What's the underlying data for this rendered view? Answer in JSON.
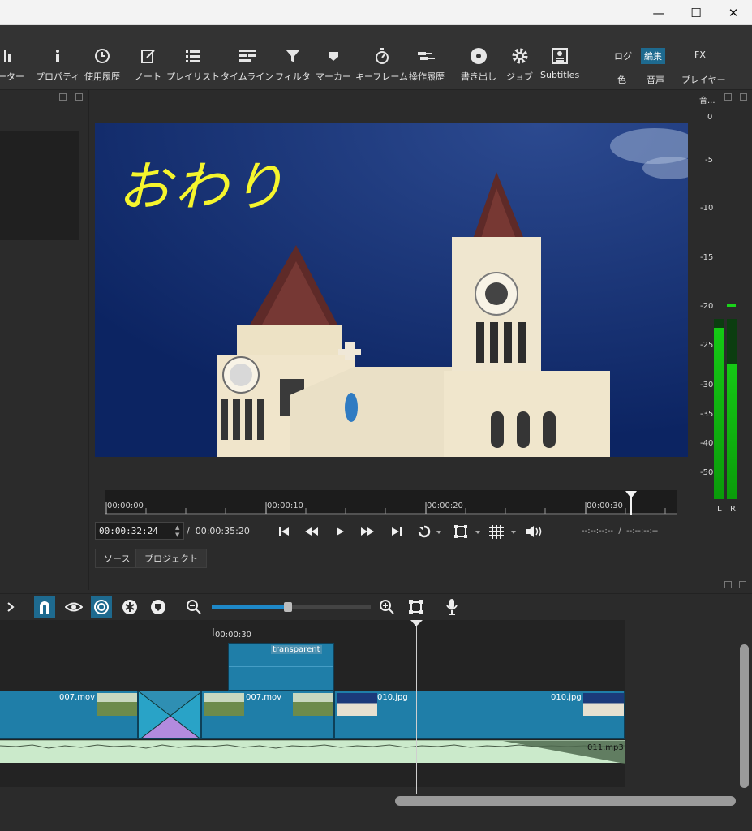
{
  "window": {
    "minimize_glyph": "—",
    "maximize_glyph": "☐",
    "close_glyph": "✕"
  },
  "toolbar": {
    "items": [
      {
        "label": "メーター",
        "icon": "meter-icon"
      },
      {
        "label": "プロパティ",
        "icon": "info-icon"
      },
      {
        "label": "使用履歴",
        "icon": "clock-icon"
      },
      {
        "label": "ノート",
        "icon": "note-icon"
      },
      {
        "label": "プレイリスト",
        "icon": "list-icon"
      },
      {
        "label": "タイムライン",
        "icon": "timeline-icon"
      },
      {
        "label": "フィルタ",
        "icon": "filter-icon"
      },
      {
        "label": "マーカー",
        "icon": "marker-icon"
      },
      {
        "label": "キーフレーム",
        "icon": "stopwatch-icon"
      },
      {
        "label": "操作履歴",
        "icon": "history-icon"
      },
      {
        "label": "書き出し",
        "icon": "disc-icon"
      },
      {
        "label": "ジョブ",
        "icon": "gear-icon"
      },
      {
        "label": "Subtitles",
        "icon": "subtitles-icon"
      }
    ],
    "layouts": {
      "log": "ログ",
      "edit": "編集",
      "fx": "FX",
      "color": "色",
      "audio": "音声",
      "player": "プレイヤー"
    }
  },
  "meter": {
    "title": "音...",
    "db_ticks": [
      "0",
      "-5",
      "-10",
      "-15",
      "-20",
      "-25",
      "-30",
      "-35",
      "-40",
      "-50"
    ],
    "left_label": "L",
    "right_label": "R",
    "left_level": 0.95,
    "right_level": 0.75
  },
  "player": {
    "overlay_text": "おわり",
    "ruler_ticks": [
      "00:00:00",
      "00:00:10",
      "00:00:20",
      "00:00:30"
    ],
    "position": "00:00:32:24",
    "separator": "/",
    "duration": "00:00:35:20",
    "in_point": "--:--:--:--",
    "out_sep": "/",
    "out_point": "--:--:--:--",
    "tabs": {
      "source": "ソース",
      "project": "プロジェクト"
    }
  },
  "timeline": {
    "ruler_label": "00:00:30",
    "zoom_level": 0.48,
    "clips": {
      "transparent": "transparent",
      "c007a": "007.mov",
      "c007b": "007.mov",
      "c010a": "010.jpg",
      "c010b": "010.jpg",
      "audio": "011.mp3"
    }
  }
}
